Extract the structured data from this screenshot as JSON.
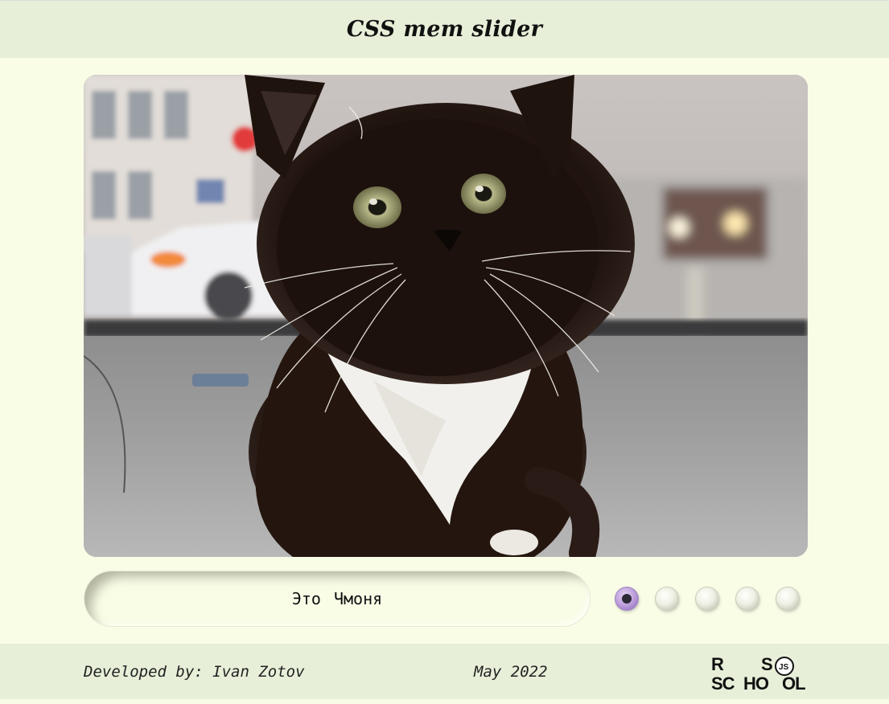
{
  "header": {
    "title": "CSS mem slider"
  },
  "slide": {
    "image_alt": "Black-and-white fluffy kitten sitting on a car dashboard",
    "caption": "Это Чмоня"
  },
  "pagination": {
    "dots": [
      {
        "label": "slide-1",
        "active": true
      },
      {
        "label": "slide-2",
        "active": false
      },
      {
        "label": "slide-3",
        "active": false
      },
      {
        "label": "slide-4",
        "active": false
      },
      {
        "label": "slide-5",
        "active": false
      }
    ],
    "active_color": "#b899d8"
  },
  "footer": {
    "developer": "Developed by: Ivan Zotov",
    "date": "May 2022",
    "logo": {
      "top": "R S",
      "bottom": "SC HO OL",
      "badge": "JS"
    }
  },
  "colors": {
    "background": "#f9fde6",
    "bars": "#e7efd8"
  }
}
